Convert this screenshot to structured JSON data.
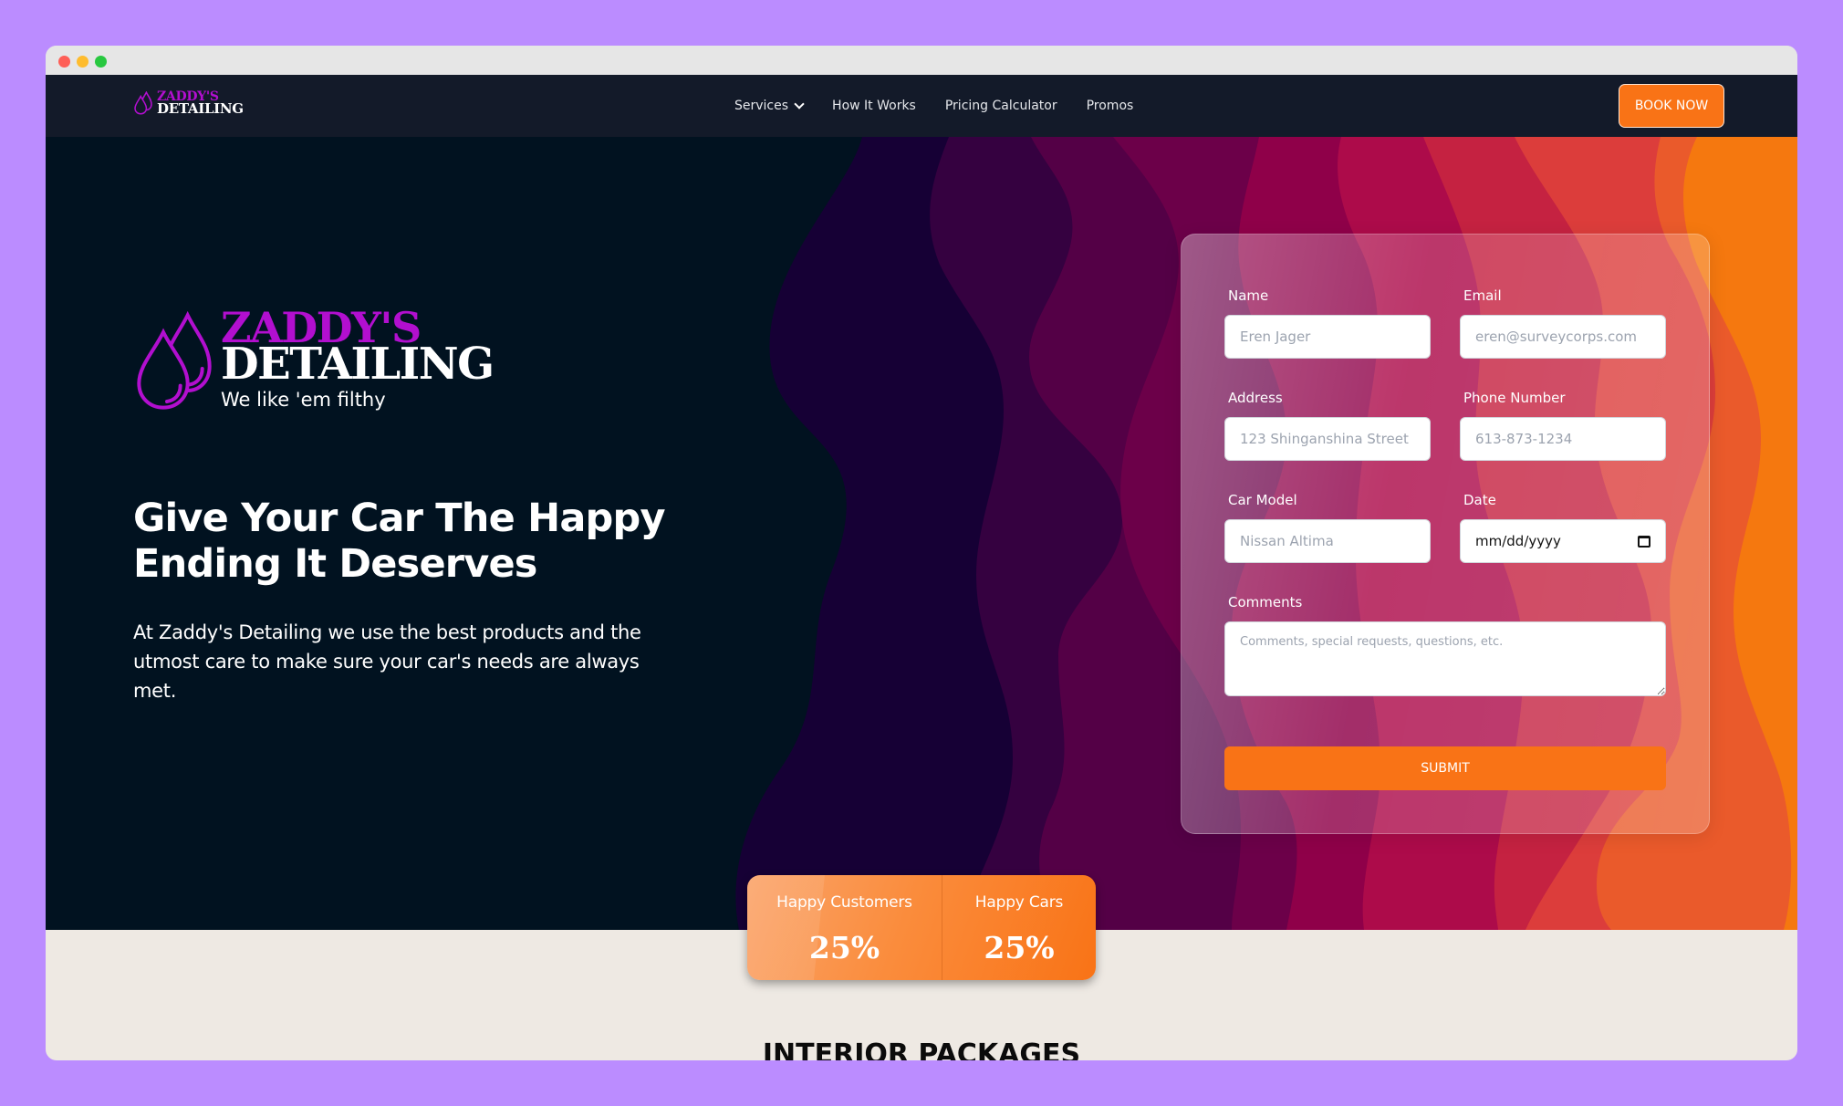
{
  "window": {
    "controls": [
      "close",
      "minimize",
      "maximize"
    ]
  },
  "nav": {
    "logo": {
      "top": "ZADDY'S",
      "bottom": "DETAILING",
      "icon": "water-drops-icon"
    },
    "links": [
      {
        "label": "Services",
        "has_dropdown": true
      },
      {
        "label": "How It Works"
      },
      {
        "label": "Pricing Calculator"
      },
      {
        "label": "Promos"
      }
    ],
    "cta_label": "BOOK NOW"
  },
  "hero": {
    "logo": {
      "top": "ZADDY'S",
      "bottom": "DETAILING",
      "tagline": "We like 'em filthy"
    },
    "title": "Give Your Car The Happy Ending It Deserves",
    "description": "At Zaddy's Detailing we use the best products and the utmost care to make sure your car's needs are always met."
  },
  "form": {
    "fields": {
      "name": {
        "label": "Name",
        "placeholder": "Eren Jager"
      },
      "email": {
        "label": "Email",
        "placeholder": "eren@surveycorps.com"
      },
      "address": {
        "label": "Address",
        "placeholder": "123 Shinganshina Street"
      },
      "phone": {
        "label": "Phone Number",
        "placeholder": "613-873-1234"
      },
      "car_model": {
        "label": "Car Model",
        "placeholder": "Nissan Altima"
      },
      "date": {
        "label": "Date",
        "value": "mm/dd/yyyy"
      },
      "comments": {
        "label": "Comments",
        "placeholder": "Comments, special requests, questions, etc."
      }
    },
    "submit_label": "SUBMIT"
  },
  "stats": [
    {
      "label": "Happy Customers",
      "value": "25%"
    },
    {
      "label": "Happy Cars",
      "value": "25%"
    }
  ],
  "sections": {
    "interior_packages_title": "INTERIOR PACKAGES"
  },
  "colors": {
    "brand_purple": "#b20fcf",
    "accent_orange": "#f97316",
    "nav_bg": "#131a29",
    "hero_bg": "#011220",
    "page_bg": "#eee9e3"
  }
}
